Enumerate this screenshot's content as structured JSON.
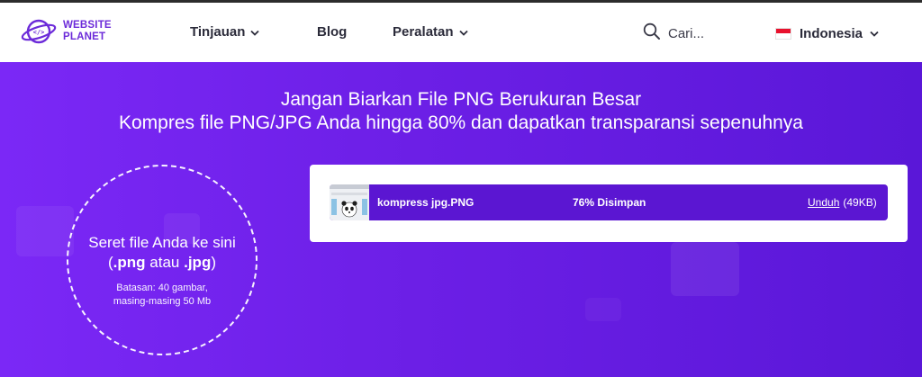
{
  "header": {
    "logo_line1": "WEBSITE",
    "logo_line2": "PLANET",
    "nav": [
      {
        "label": "Tinjauan",
        "has_dropdown": true
      },
      {
        "label": "Blog",
        "has_dropdown": false
      },
      {
        "label": "Peralatan",
        "has_dropdown": true
      }
    ],
    "search_placeholder": "Cari...",
    "language": "Indonesia",
    "icons": {
      "logo": "website-planet-logo-icon",
      "search": "search-icon",
      "flag": "indonesia-flag-icon",
      "chevron": "chevron-down-icon"
    }
  },
  "hero": {
    "title": "Jangan Biarkan File PNG Berukuran Besar",
    "subtitle": "Kompres file PNG/JPG Anda hingga 80% dan dapatkan transparansi sepenuhnya",
    "drop": {
      "line1": "Seret file Anda ke sini",
      "open_paren": "(",
      "png": ".png",
      "atau": "atau",
      "jpg": ".jpg",
      "close_paren": ")",
      "limit_line1": "Batasan: 40 gambar,",
      "limit_line2": "masing-masing 50 Mb"
    }
  },
  "results": [
    {
      "filename": "kompress jpg.PNG",
      "saved": "76% Disimpan",
      "download_label": "Unduh",
      "size": "(49KB)"
    }
  ],
  "colors": {
    "brand": "#6c2bd9",
    "hero_start": "#7b28f6",
    "hero_end": "#5a17d8",
    "row": "#5b16d2"
  }
}
